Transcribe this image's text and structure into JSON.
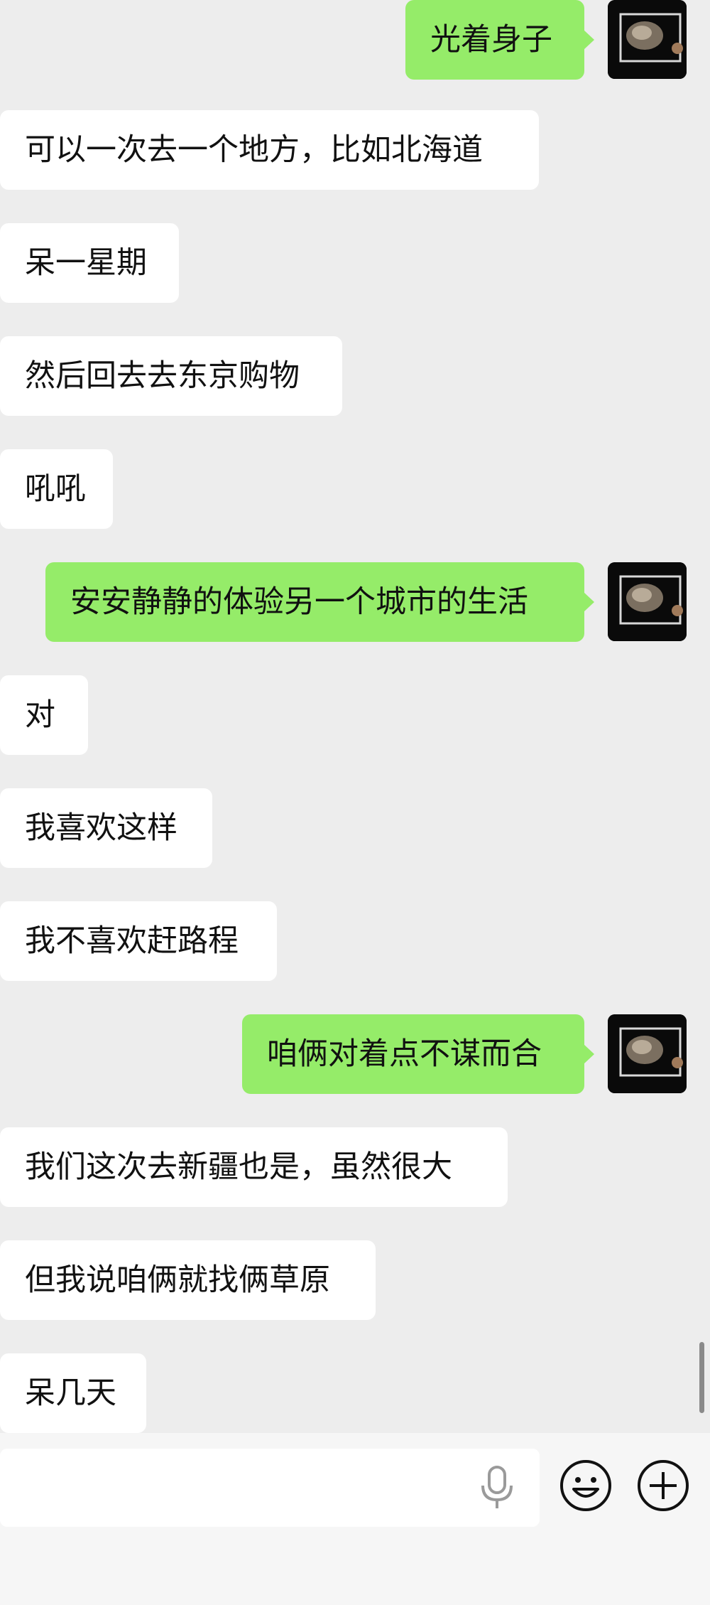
{
  "messages": [
    {
      "side": "out",
      "text": "光着身子"
    },
    {
      "side": "in",
      "text": "可以一次去一个地方，比如北海道"
    },
    {
      "side": "in",
      "text": "呆一星期"
    },
    {
      "side": "in",
      "text": "然后回去去东京购物"
    },
    {
      "side": "in",
      "text": "吼吼"
    },
    {
      "side": "out",
      "text": "安安静静的体验另一个城市的生活"
    },
    {
      "side": "in",
      "text": "对"
    },
    {
      "side": "in",
      "text": "我喜欢这样"
    },
    {
      "side": "in",
      "text": "我不喜欢赶路程"
    },
    {
      "side": "out",
      "text": "咱俩对着点不谋而合"
    },
    {
      "side": "in",
      "text": "我们这次去新疆也是，虽然很大"
    },
    {
      "side": "in",
      "text": "但我说咱俩就找俩草原"
    },
    {
      "side": "in",
      "text": "呆几天"
    }
  ],
  "input_bar": {
    "text_value": "",
    "icons": [
      "microphone-icon",
      "emoji-icon",
      "plus-icon"
    ]
  },
  "colors": {
    "background": "#ededed",
    "incoming_bubble": "#ffffff",
    "outgoing_bubble": "#95ec69",
    "input_bar": "#f6f6f6"
  }
}
